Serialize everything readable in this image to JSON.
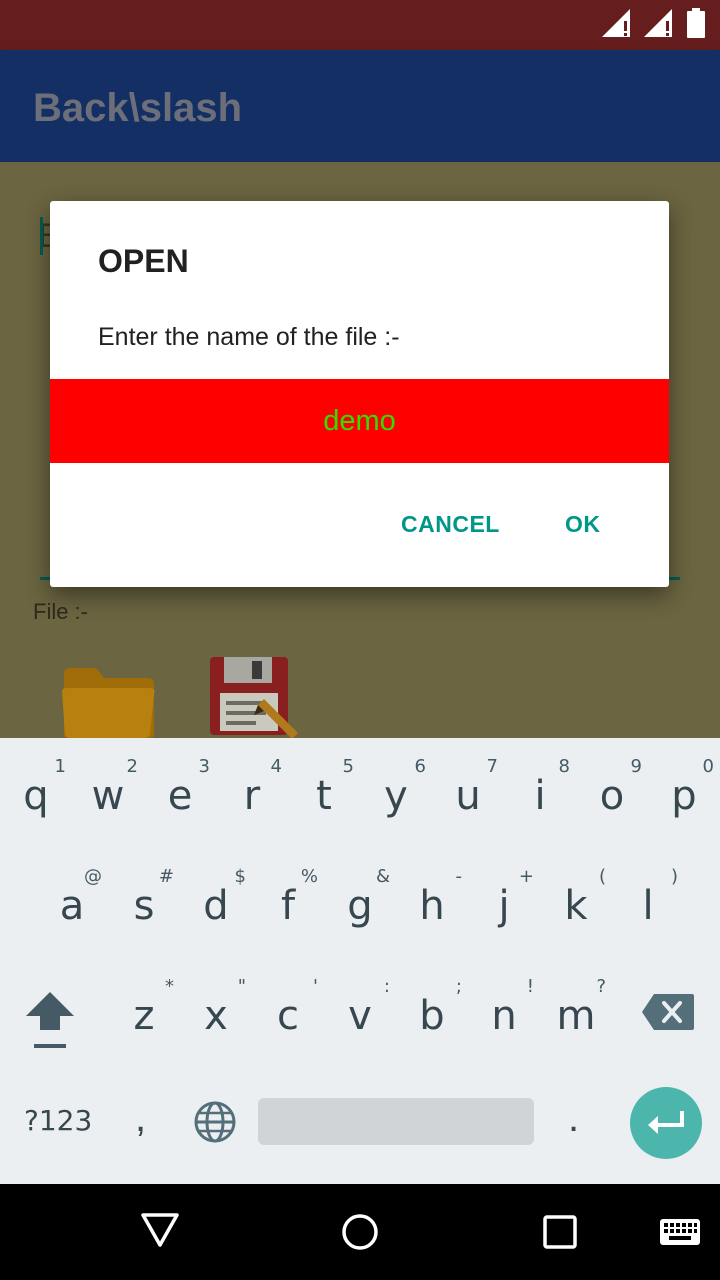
{
  "app": {
    "title": "Back\\slash"
  },
  "editor": {
    "partial_text": "B"
  },
  "file_section": {
    "label": "File :-"
  },
  "dialog": {
    "title": "OPEN",
    "message": "Enter the name of the file :-",
    "input_value": "demo",
    "cancel_label": "CANCEL",
    "ok_label": "OK"
  },
  "keyboard": {
    "row1": [
      {
        "key": "q",
        "hint": "1"
      },
      {
        "key": "w",
        "hint": "2"
      },
      {
        "key": "e",
        "hint": "3"
      },
      {
        "key": "r",
        "hint": "4"
      },
      {
        "key": "t",
        "hint": "5"
      },
      {
        "key": "y",
        "hint": "6"
      },
      {
        "key": "u",
        "hint": "7"
      },
      {
        "key": "i",
        "hint": "8"
      },
      {
        "key": "o",
        "hint": "9"
      },
      {
        "key": "p",
        "hint": "0"
      }
    ],
    "row2": [
      {
        "key": "a",
        "hint": "@"
      },
      {
        "key": "s",
        "hint": "#"
      },
      {
        "key": "d",
        "hint": "$"
      },
      {
        "key": "f",
        "hint": "%"
      },
      {
        "key": "g",
        "hint": "&"
      },
      {
        "key": "h",
        "hint": "-"
      },
      {
        "key": "j",
        "hint": "+"
      },
      {
        "key": "k",
        "hint": "("
      },
      {
        "key": "l",
        "hint": ")"
      }
    ],
    "row3": [
      {
        "key": "z",
        "hint": "*"
      },
      {
        "key": "x",
        "hint": "\""
      },
      {
        "key": "c",
        "hint": "'"
      },
      {
        "key": "v",
        "hint": ":"
      },
      {
        "key": "b",
        "hint": ";"
      },
      {
        "key": "n",
        "hint": "!"
      },
      {
        "key": "m",
        "hint": "?"
      }
    ],
    "symbols_label": "?123",
    "comma": ",",
    "period": "."
  },
  "colors": {
    "status_bar": "#651d1d",
    "app_bar": "#132f64",
    "dialog_input_bg": "#ff0000",
    "dialog_input_text": "#33dd00",
    "accent": "#009688"
  }
}
